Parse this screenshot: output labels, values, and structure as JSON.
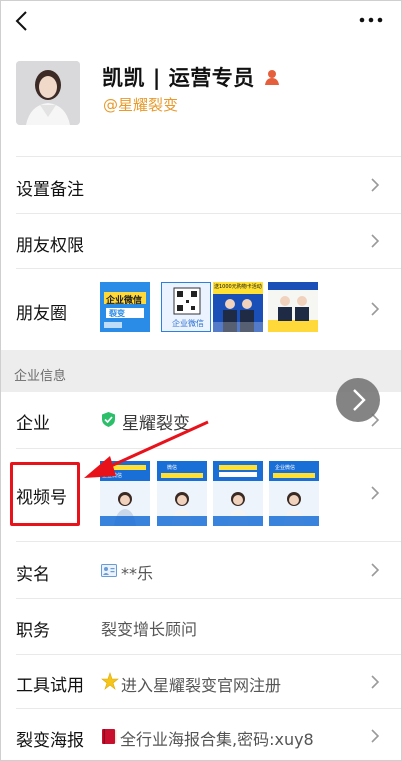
{
  "profile": {
    "name": "凯凯 | 运营专员",
    "handle": "@星耀裂变"
  },
  "rows": {
    "remark": {
      "label": "设置备注"
    },
    "permission": {
      "label": "朋友权限"
    },
    "moments": {
      "label": "朋友圈",
      "thumbs": [
        {
          "line1": "企业微信",
          "line2": "裂变"
        },
        {
          "caption": "企业微信"
        },
        {
          "banner": "送1000元购物卡活动"
        },
        {
          "banner": ""
        }
      ]
    }
  },
  "section": {
    "title": "企业信息"
  },
  "enterprise": {
    "company": {
      "label": "企业",
      "value": "星耀裂变"
    },
    "channels": {
      "label": "视频号",
      "thumbs": [
        {
          "banner": "企业微信"
        },
        {
          "banner": "微信"
        },
        {
          "banner": ""
        },
        {
          "banner": "企业微信"
        }
      ]
    },
    "realname": {
      "label": "实名",
      "value": "**乐"
    },
    "position": {
      "label": "职务",
      "value": "裂变增长顾问"
    },
    "tool": {
      "label": "工具试用",
      "value": "进入星耀裂变官网注册"
    },
    "poster": {
      "label": "裂变海报",
      "value": "全行业海报合集,密码:xuy8"
    }
  },
  "colors": {
    "accent_orange": "#e89a2c",
    "annotation_red": "#e8121b",
    "section_bg": "#ededed",
    "verified_green": "#2bbf6a"
  }
}
